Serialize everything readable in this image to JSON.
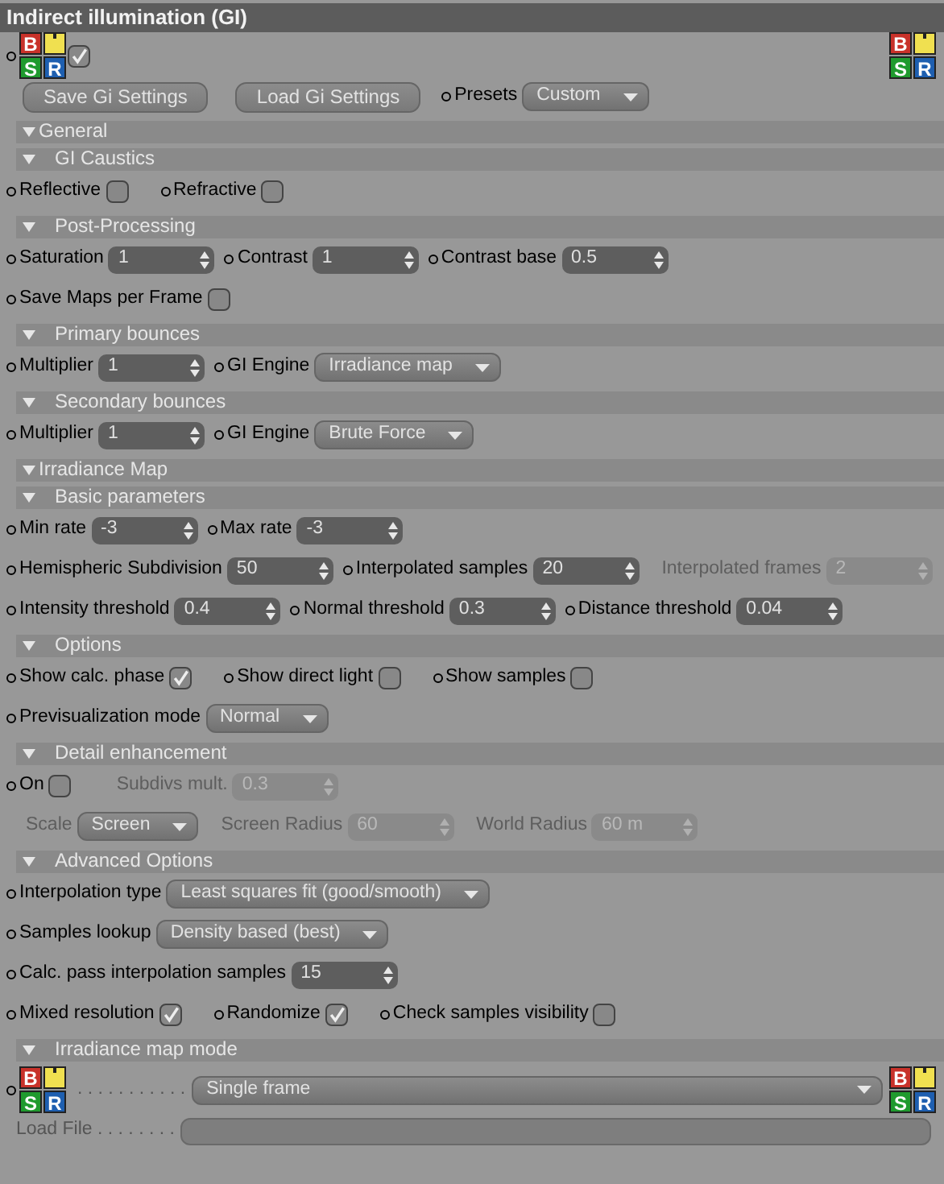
{
  "window": {
    "title": "Indirect illumination (GI)"
  },
  "rows": [
    {
      "kind": "controls",
      "items": [
        {
          "kind": "dot"
        },
        {
          "kind": "bsr",
          "b": "B",
          "s": "S",
          "r": "R"
        },
        {
          "kind": "check",
          "checked": true
        },
        {
          "kind": "fill"
        },
        {
          "kind": "bsr",
          "b": "B",
          "s": "S",
          "r": "R"
        }
      ]
    },
    {
      "kind": "controls",
      "items": [
        {
          "kind": "button",
          "label": "Save Gi Settings"
        },
        {
          "kind": "button",
          "label": "Load Gi Settings"
        },
        {
          "kind": "label",
          "text": "Presets",
          "dot": true
        },
        {
          "kind": "select",
          "value": "Custom"
        }
      ]
    },
    {
      "kind": "group",
      "label": "General",
      "expanded": true
    },
    {
      "kind": "subgroup",
      "label": "GI Caustics",
      "expanded": true
    },
    {
      "kind": "controls",
      "items": [
        {
          "kind": "label",
          "text": "Reflective",
          "dot": true
        },
        {
          "kind": "check",
          "checked": false
        },
        {
          "kind": "label",
          "text": "Refractive",
          "dot": true
        },
        {
          "kind": "check",
          "checked": false
        }
      ]
    },
    {
      "kind": "subgroup",
      "label": "Post-Processing",
      "expanded": true
    },
    {
      "kind": "controls",
      "items": [
        {
          "kind": "label",
          "text": "Saturation",
          "dot": true
        },
        {
          "kind": "number",
          "value": "1"
        },
        {
          "kind": "label",
          "text": "Contrast",
          "dot": true
        },
        {
          "kind": "number",
          "value": "1"
        },
        {
          "kind": "label",
          "text": "Contrast base",
          "dot": true
        },
        {
          "kind": "number",
          "value": "0.5"
        }
      ]
    },
    {
      "kind": "controls",
      "items": [
        {
          "kind": "label",
          "text": "Save Maps per Frame",
          "dot": true
        },
        {
          "kind": "check",
          "checked": false
        }
      ]
    },
    {
      "kind": "subgroup",
      "label": "Primary bounces",
      "expanded": true
    },
    {
      "kind": "controls",
      "items": [
        {
          "kind": "label",
          "text": "Multiplier",
          "dot": true
        },
        {
          "kind": "number",
          "value": "1"
        },
        {
          "kind": "label",
          "text": "GI Engine",
          "dot": true
        },
        {
          "kind": "select",
          "value": "Irradiance map"
        }
      ]
    },
    {
      "kind": "subgroup",
      "label": "Secondary bounces",
      "expanded": true
    },
    {
      "kind": "controls",
      "items": [
        {
          "kind": "label",
          "text": "Multiplier",
          "dot": true
        },
        {
          "kind": "number",
          "value": "1"
        },
        {
          "kind": "label",
          "text": "GI Engine",
          "dot": true
        },
        {
          "kind": "select",
          "value": "Brute Force"
        }
      ]
    },
    {
      "kind": "group",
      "label": "Irradiance Map",
      "expanded": true
    },
    {
      "kind": "subgroup",
      "label": "Basic parameters",
      "expanded": true
    },
    {
      "kind": "controls",
      "items": [
        {
          "kind": "label",
          "text": "Min rate",
          "dot": true
        },
        {
          "kind": "number",
          "value": "-3"
        },
        {
          "kind": "label",
          "text": "Max rate",
          "dot": true
        },
        {
          "kind": "number",
          "value": "-3"
        }
      ]
    },
    {
      "kind": "controls",
      "items": [
        {
          "kind": "label",
          "text": "Hemispheric Subdivision",
          "dot": true
        },
        {
          "kind": "number",
          "value": "50"
        },
        {
          "kind": "label",
          "text": "Interpolated samples",
          "dot": true
        },
        {
          "kind": "number",
          "value": "20"
        },
        {
          "kind": "label",
          "text": "Interpolated frames",
          "disabled": true
        },
        {
          "kind": "number",
          "value": "2",
          "disabled": true
        }
      ]
    },
    {
      "kind": "controls",
      "items": [
        {
          "kind": "label",
          "text": "Intensity threshold",
          "dot": true
        },
        {
          "kind": "number",
          "value": "0.4"
        },
        {
          "kind": "label",
          "text": "Normal threshold",
          "dot": true
        },
        {
          "kind": "number",
          "value": "0.3"
        },
        {
          "kind": "label",
          "text": "Distance threshold",
          "dot": true
        },
        {
          "kind": "number",
          "value": "0.04"
        }
      ]
    },
    {
      "kind": "subgroup",
      "label": "Options",
      "expanded": true
    },
    {
      "kind": "controls",
      "items": [
        {
          "kind": "label",
          "text": "Show calc. phase",
          "dot": true
        },
        {
          "kind": "check",
          "checked": true
        },
        {
          "kind": "label",
          "text": "Show direct light",
          "dot": true
        },
        {
          "kind": "check",
          "checked": false
        },
        {
          "kind": "label",
          "text": "Show samples",
          "dot": true
        },
        {
          "kind": "check",
          "checked": false
        }
      ]
    },
    {
      "kind": "controls",
      "items": [
        {
          "kind": "label",
          "text": "Previsualization mode",
          "dot": true
        },
        {
          "kind": "select",
          "value": "Normal"
        }
      ]
    },
    {
      "kind": "subgroup",
      "label": "Detail enhancement",
      "expanded": true
    },
    {
      "kind": "controls",
      "items": [
        {
          "kind": "label",
          "text": "On",
          "dot": true
        },
        {
          "kind": "check",
          "checked": false
        },
        {
          "kind": "label",
          "text": "Subdivs mult.",
          "disabled": true
        },
        {
          "kind": "number",
          "value": "0.3",
          "disabled": true
        }
      ]
    },
    {
      "kind": "controls",
      "items": [
        {
          "kind": "label",
          "text": "Scale",
          "disabled": true
        },
        {
          "kind": "select",
          "value": "Screen"
        },
        {
          "kind": "label",
          "text": "Screen Radius",
          "disabled": true
        },
        {
          "kind": "number",
          "value": "60",
          "disabled": true
        },
        {
          "kind": "label",
          "text": "World Radius",
          "disabled": true
        },
        {
          "kind": "number",
          "value": "60 m",
          "disabled": true
        }
      ]
    },
    {
      "kind": "subgroup",
      "label": "Advanced Options",
      "expanded": true
    },
    {
      "kind": "controls",
      "items": [
        {
          "kind": "label",
          "text": "Interpolation type",
          "dot": true
        },
        {
          "kind": "select",
          "value": "Least squares fit (good/smooth)"
        }
      ]
    },
    {
      "kind": "controls",
      "items": [
        {
          "kind": "label",
          "text": "Samples lookup",
          "dot": true
        },
        {
          "kind": "select",
          "value": "Density based (best)"
        }
      ]
    },
    {
      "kind": "controls",
      "items": [
        {
          "kind": "label",
          "text": "Calc. pass interpolation samples",
          "dot": true
        },
        {
          "kind": "number",
          "value": "15"
        }
      ]
    },
    {
      "kind": "controls",
      "items": [
        {
          "kind": "label",
          "text": "Mixed resolution",
          "dot": true
        },
        {
          "kind": "check",
          "checked": true
        },
        {
          "kind": "label",
          "text": "Randomize",
          "dot": true
        },
        {
          "kind": "check",
          "checked": true
        },
        {
          "kind": "label",
          "text": "Check samples visibility",
          "dot": true
        },
        {
          "kind": "check",
          "checked": false
        }
      ]
    },
    {
      "kind": "subgroup",
      "label": "Irradiance map mode",
      "expanded": true
    },
    {
      "kind": "controls",
      "items": [
        {
          "kind": "dot"
        },
        {
          "kind": "bsr",
          "b": "B",
          "s": "S",
          "r": "R"
        },
        {
          "kind": "leader",
          "text": ". . . . . . . . . . ."
        },
        {
          "kind": "wide-select",
          "value": "Single frame"
        },
        {
          "kind": "bsr",
          "b": "B",
          "s": "S",
          "r": "R"
        }
      ]
    },
    {
      "kind": "controls",
      "items": [
        {
          "kind": "leader",
          "text": "Load File . . . . . . . ."
        },
        {
          "kind": "field"
        }
      ]
    }
  ]
}
